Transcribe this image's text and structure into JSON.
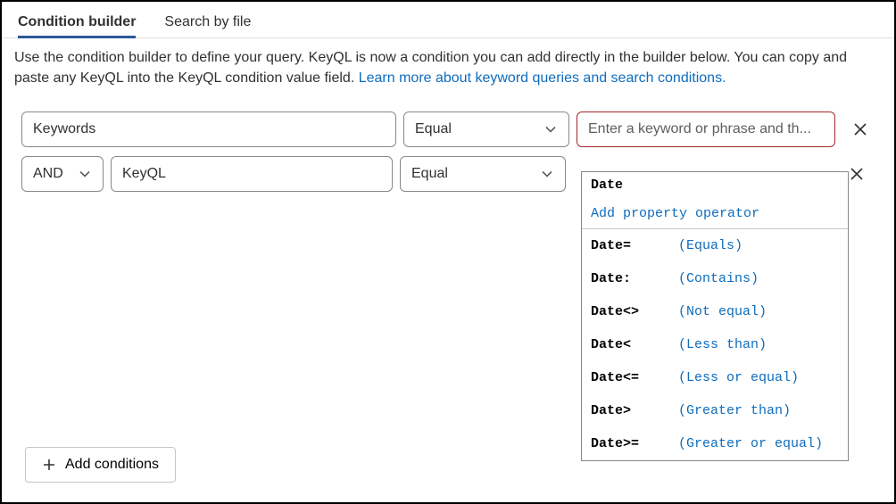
{
  "tabs": {
    "condition_builder": "Condition builder",
    "search_by_file": "Search by file"
  },
  "description": {
    "text": "Use the condition builder to define your query. KeyQL is now a condition you can add directly in the builder below. You can copy and paste any KeyQL into the KeyQL condition value field. ",
    "link": "Learn more about keyword queries and search conditions."
  },
  "rows": [
    {
      "property": "Keywords",
      "operator": "Equal",
      "value": "",
      "placeholder": "Enter a keyword or phrase and th..."
    },
    {
      "logic": "AND",
      "property": "KeyQL",
      "operator": "Equal",
      "value": "Date"
    }
  ],
  "dropdown": {
    "typed": "Date",
    "header": "Add property operator",
    "items": [
      {
        "op": "Date=",
        "desc": "(Equals)"
      },
      {
        "op": "Date:",
        "desc": "(Contains)"
      },
      {
        "op": "Date<>",
        "desc": "(Not equal)"
      },
      {
        "op": "Date<",
        "desc": "(Less than)"
      },
      {
        "op": "Date<=",
        "desc": "(Less or equal)"
      },
      {
        "op": "Date>",
        "desc": "(Greater than)"
      },
      {
        "op": "Date>=",
        "desc": "(Greater or equal)"
      }
    ]
  },
  "buttons": {
    "add_conditions": "Add conditions"
  }
}
